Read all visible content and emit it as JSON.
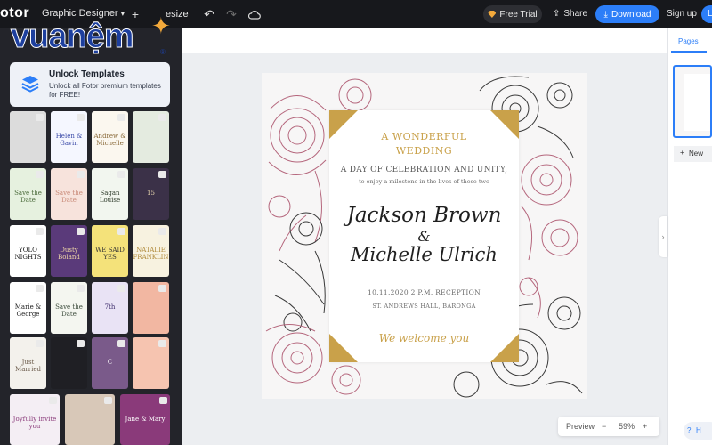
{
  "topbar": {
    "brand": "otor",
    "doc_type": "Graphic Designer",
    "resize_label": "esize",
    "free_trial_label": "Free Trial",
    "share_label": "Share",
    "download_label": "Download",
    "signup_label": "Sign up",
    "login_stub": "L"
  },
  "logo": {
    "text": "vuanệm",
    "registered": "®"
  },
  "left_panel": {
    "unlock_title": "Unlock Templates",
    "unlock_desc": "Unlock all Fotor premium templates for FREE!",
    "templates": [
      {
        "text": "",
        "bg": "#dcdcdc",
        "fg": "#333"
      },
      {
        "text": "Helen & Gavin",
        "bg": "#f5f7ff",
        "fg": "#3a4aa8"
      },
      {
        "text": "Andrew & Michelle",
        "bg": "#fbf7ef",
        "fg": "#8a6a3a"
      },
      {
        "text": "",
        "bg": "#e4ebe0",
        "fg": "#555"
      },
      {
        "text": "Save the Date",
        "bg": "#e6f1df",
        "fg": "#4a6b3a"
      },
      {
        "text": "Save the Date",
        "bg": "#f7e3dc",
        "fg": "#c98a78"
      },
      {
        "text": "Sagan Louise",
        "bg": "#f2f6ef",
        "fg": "#2d3a2a"
      },
      {
        "text": "15",
        "bg": "#3b3148",
        "fg": "#e9d8b0"
      },
      {
        "text": "YOLO NIGHTS",
        "bg": "#ffffff",
        "fg": "#111"
      },
      {
        "text": "Dusty Boland",
        "bg": "#5a3a7a",
        "fg": "#f2d9a8"
      },
      {
        "text": "WE SAID YES",
        "bg": "#f4e27a",
        "fg": "#333"
      },
      {
        "text": "NATALIE FRANKLIN",
        "bg": "#f7f2e0",
        "fg": "#b08a3a"
      },
      {
        "text": "Marie & George",
        "bg": "#ffffff",
        "fg": "#222"
      },
      {
        "text": "Save the Date",
        "bg": "#f4f6f0",
        "fg": "#3a4a3a"
      },
      {
        "text": "7th",
        "bg": "#e9e3f5",
        "fg": "#3b2a6a"
      },
      {
        "text": "",
        "bg": "#f2b7a2",
        "fg": "#fff"
      },
      {
        "text": "Just Married",
        "bg": "#f3f1ec",
        "fg": "#6a5a4a"
      },
      {
        "text": "",
        "bg": "#1f1f24",
        "fg": "#e0c070"
      },
      {
        "text": "C",
        "bg": "#7a5a8a",
        "fg": "#fff"
      },
      {
        "text": "",
        "bg": "#f6c4b0",
        "fg": "#fff"
      },
      {
        "text": "Joyfully invite you",
        "bg": "#f4eef4",
        "fg": "#8a3a7a"
      },
      {
        "text": "",
        "bg": "#d8c8b8",
        "fg": "#333"
      },
      {
        "text": "Jane & Mary",
        "bg": "#8a3a7a",
        "fg": "#fff"
      }
    ]
  },
  "invitation": {
    "title_line1": "A WONDERFUL",
    "title_line2": "WEDDING",
    "subtitle": "A DAY OF CELEBRATION AND UNITY,",
    "subtitle2": "to enjoy a milestone in the lives of these two",
    "name1": "Jackson Brown",
    "ampersand": "&",
    "name2": "Michelle Ulrich",
    "date_line": "10.11.2020  2 P.M. RECEPTION",
    "venue": "ST. ANDREWS HALL, BARONGA",
    "welcome": "We welcome you"
  },
  "zoom": {
    "preview_label": "Preview",
    "minus": "−",
    "value": "59%",
    "plus": "+"
  },
  "right_panel": {
    "pages_tab": "Pages",
    "new_page_label": "New",
    "help_label": "H"
  },
  "colors": {
    "accent": "#2c7ef8",
    "gold": "#c9a14a",
    "floral_pink": "#b5677d",
    "floral_dark": "#3a3a3a"
  }
}
